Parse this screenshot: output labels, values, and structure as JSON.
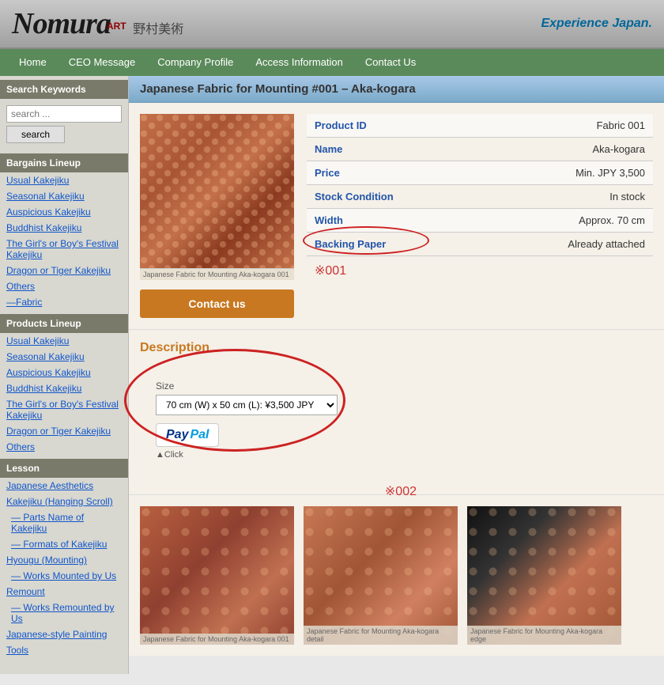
{
  "header": {
    "logo_main": "Nomura",
    "logo_art": "ART",
    "logo_jp": "野村美術",
    "tagline": "Experience Japan."
  },
  "nav": {
    "items": [
      {
        "label": "Home",
        "id": "home"
      },
      {
        "label": "CEO Message",
        "id": "ceo"
      },
      {
        "label": "Company Profile",
        "id": "company"
      },
      {
        "label": "Access Information",
        "id": "access"
      },
      {
        "label": "Contact Us",
        "id": "contact"
      }
    ]
  },
  "sidebar": {
    "search": {
      "placeholder": "search ...",
      "button_label": "search"
    },
    "bargains": {
      "title": "Bargains Lineup",
      "items": [
        "Usual Kakejiku",
        "Seasonal Kakejiku",
        "Auspicious Kakejiku",
        "Buddhist Kakejiku",
        "The Girl's or Boy's Festival Kakejiku",
        "Dragon or Tiger Kakejiku",
        "Others",
        "—Fabric"
      ]
    },
    "products": {
      "title": "Products Lineup",
      "items": [
        "Usual Kakejiku",
        "Seasonal Kakejiku",
        "Auspicious Kakejiku",
        "Buddhist Kakejiku",
        "The Girl's or Boy's Festival Kakejiku",
        "Dragon or Tiger Kakejiku",
        "Others"
      ]
    },
    "lesson": {
      "title": "Lesson",
      "items": [
        "Japanese Aesthetics",
        "Kakejiku (Hanging Scroll)",
        "— Parts Name of Kakejiku",
        "— Formats of Kakejiku",
        "Hyougu (Mounting)",
        "— Works Mounted by Us",
        "Remount",
        "— Works Remounted by Us",
        "Japanese-style Painting",
        "Tools"
      ]
    }
  },
  "product": {
    "page_title": "Japanese Fabric for Mounting #001 – Aka-kogara",
    "fields": [
      {
        "label": "Product ID",
        "value": "Fabric 001"
      },
      {
        "label": "Name",
        "value": "Aka-kogara"
      },
      {
        "label": "Price",
        "value": "Min. JPY 3,500"
      },
      {
        "label": "Stock Condition",
        "value": "In stock"
      },
      {
        "label": "Width",
        "value": "Approx. 70 cm"
      },
      {
        "label": "Backing Paper",
        "value": "Already attached"
      }
    ],
    "note_001": "※001",
    "contact_button": "Contact us",
    "description_title": "Description",
    "size_label": "Size",
    "size_option": "70 cm (W) x 50 cm (L): ¥3,500 JPY",
    "click_label": "▲Click",
    "note_002": "※002",
    "img_caption_main": "Japanese Fabric for Mounting Aka-kogara 001",
    "img_caption_1": "Japanese Fabric for Mounting Aka-kogara 001",
    "img_caption_2": "Japanese Fabric for Mounting Aka-kogara detail",
    "img_caption_3": "Japanese Fabric for Mounting Aka-kogara edge"
  }
}
